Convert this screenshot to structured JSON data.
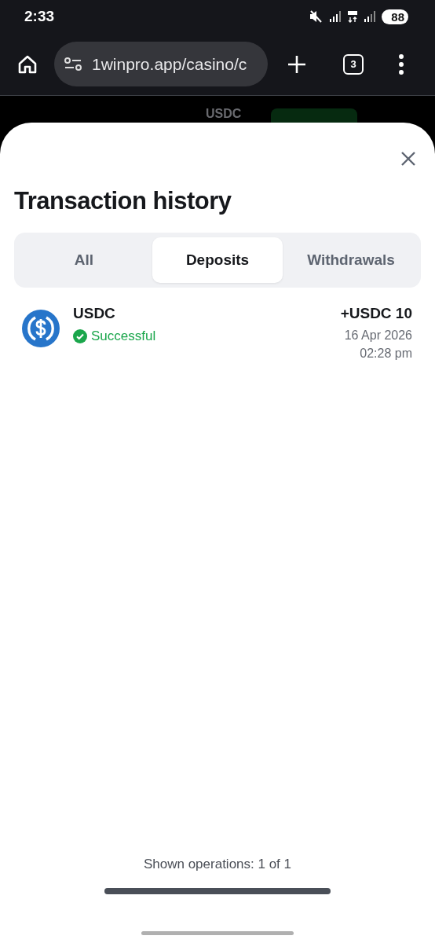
{
  "status_bar": {
    "time": "2:33",
    "battery": "88"
  },
  "browser": {
    "url": "1winpro.app/casino/c",
    "tab_count": "3"
  },
  "backdrop": {
    "currency": "USDC"
  },
  "sheet": {
    "title": "Transaction history",
    "tabs": [
      {
        "label": "All",
        "selected": false
      },
      {
        "label": "Deposits",
        "selected": true
      },
      {
        "label": "Withdrawals",
        "selected": false
      }
    ],
    "transactions": [
      {
        "currency": "USDC",
        "status": "Successful",
        "kind": "success",
        "amount": "+USDC 10",
        "date": "16 Apr 2026",
        "time": "02:28 pm"
      }
    ],
    "footer": {
      "summary": "Shown operations: 1 of 1",
      "level": 1
    }
  }
}
